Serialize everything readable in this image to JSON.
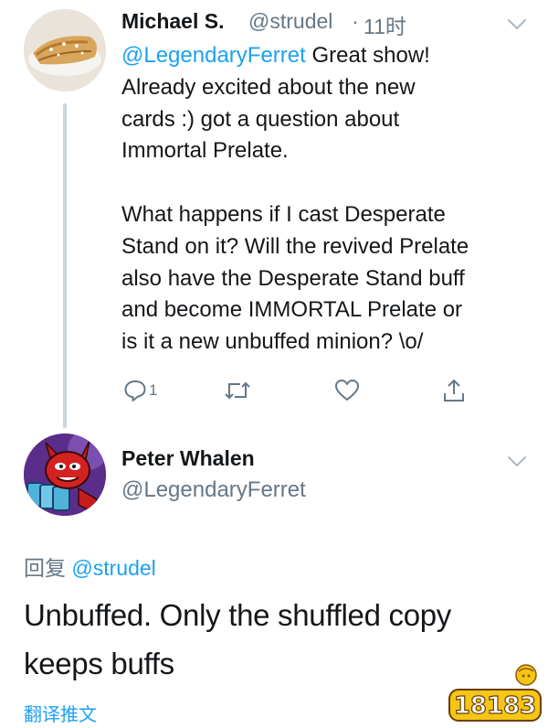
{
  "tweet1": {
    "avatar_icon": "strudel-pastry-avatar",
    "name": "Michael S.",
    "handle": "@strudel",
    "separator": "·",
    "time": "11时",
    "mention": "@LegendaryFerret",
    "lines": [
      " Great show!",
      "Already excited about the new",
      "cards :) got a question about",
      "Immortal Prelate.",
      "",
      "What happens if I cast Desperate",
      "Stand on it? Will the revived Prelate",
      "also have the Desperate Stand buff",
      "and become IMMORTAL Prelate or",
      "is it a new unbuffed minion? \\o/"
    ],
    "actions": {
      "reply_icon": "reply-icon",
      "reply_count": "1",
      "retweet_icon": "retweet-icon",
      "like_icon": "heart-icon",
      "share_icon": "share-icon"
    },
    "menu_icon": "chevron-down-icon"
  },
  "tweet2": {
    "avatar_icon": "red-devil-cards-avatar",
    "name": "Peter Whalen",
    "handle": "@LegendaryFerret",
    "menu_icon": "chevron-down-icon",
    "reply_prefix": "回复 ",
    "reply_mention": "@strudel",
    "lines": [
      "Unbuffed. Only the shuffled copy",
      "keeps buffs"
    ],
    "translate_label": "翻译推文"
  },
  "watermark": {
    "text": "18183",
    "icon": "watermark-logo"
  },
  "colors": {
    "link_blue": "#1da1f2",
    "secondary_gray": "#657786",
    "text_dark": "#14171a",
    "thread_line": "#ccd6dd"
  }
}
